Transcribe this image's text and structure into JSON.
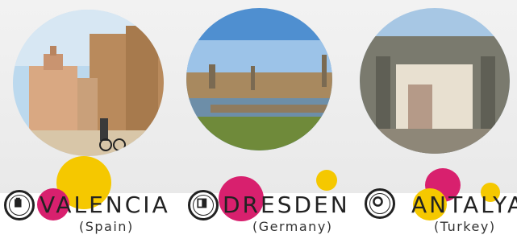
{
  "cities": [
    {
      "name": "VALENCIA",
      "country": "(Spain)",
      "emblem_icon": "valencia-coat-of-arms-icon"
    },
    {
      "name": "DRESDEN",
      "country": "(Germany)",
      "emblem_icon": "dresden-coat-of-arms-icon"
    },
    {
      "name": "ANTALYA",
      "country": "(Turkey)",
      "emblem_icon": "antalya-emblem-icon"
    }
  ],
  "colors": {
    "magenta": "#d8206e",
    "yellow": "#f5c800",
    "text": "#222222"
  }
}
